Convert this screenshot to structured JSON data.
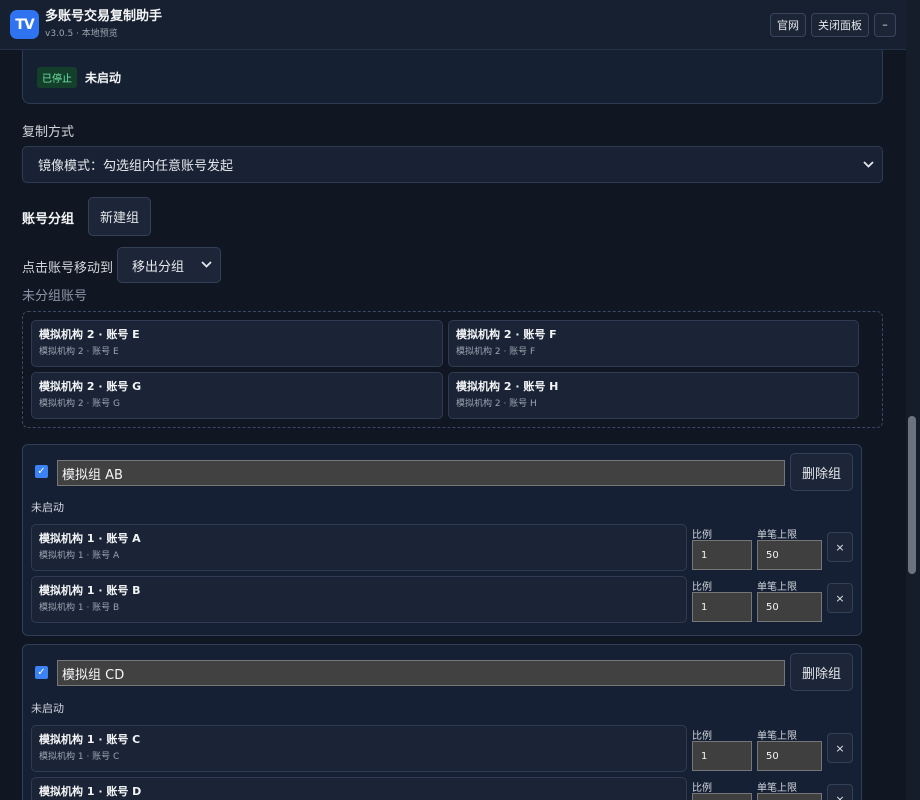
{
  "header": {
    "logo_text": "TV",
    "title": "多账号交易复制助手",
    "subtitle": "v3.0.5 · 本地预览",
    "buttons": {
      "official": "官网",
      "close_panel": "关闭面板",
      "minimize": "–"
    }
  },
  "status": {
    "badge": "已停止",
    "text": "未启动"
  },
  "copy_mode": {
    "label": "复制方式",
    "selected": "镜像模式：勾选组内任意账号发起"
  },
  "groups_section": {
    "title": "账号分组",
    "new_group": "新建组",
    "move_label": "点击账号移动到",
    "move_selected": "移出分组"
  },
  "ungrouped": {
    "label": "未分组账号",
    "accounts": [
      {
        "name": "模拟机构 2 · 账号 E",
        "sub": "模拟机构 2 · 账号 E"
      },
      {
        "name": "模拟机构 2 · 账号 F",
        "sub": "模拟机构 2 · 账号 F"
      },
      {
        "name": "模拟机构 2 · 账号 G",
        "sub": "模拟机构 2 · 账号 G"
      },
      {
        "name": "模拟机构 2 · 账号 H",
        "sub": "模拟机构 2 · 账号 H"
      }
    ]
  },
  "groups": [
    {
      "name": "模拟组 AB",
      "delete": "删除组",
      "status": "未启动",
      "checked": true,
      "members": [
        {
          "name": "模拟机构 1 · 账号 A",
          "sub": "模拟机构 1 · 账号 A",
          "ratio_label": "比例",
          "ratio": "1",
          "limit_label": "单笔上限",
          "limit": "50",
          "remove": "×"
        },
        {
          "name": "模拟机构 1 · 账号 B",
          "sub": "模拟机构 1 · 账号 B",
          "ratio_label": "比例",
          "ratio": "1",
          "limit_label": "单笔上限",
          "limit": "50",
          "remove": "×"
        }
      ]
    },
    {
      "name": "模拟组 CD",
      "delete": "删除组",
      "status": "未启动",
      "checked": true,
      "members": [
        {
          "name": "模拟机构 1 · 账号 C",
          "sub": "模拟机构 1 · 账号 C",
          "ratio_label": "比例",
          "ratio": "1",
          "limit_label": "单笔上限",
          "limit": "50",
          "remove": "×"
        },
        {
          "name": "模拟机构 1 · 账号 D",
          "sub": "",
          "ratio_label": "比例",
          "ratio": "",
          "limit_label": "单笔上限",
          "limit": "",
          "remove": "×"
        }
      ]
    }
  ]
}
